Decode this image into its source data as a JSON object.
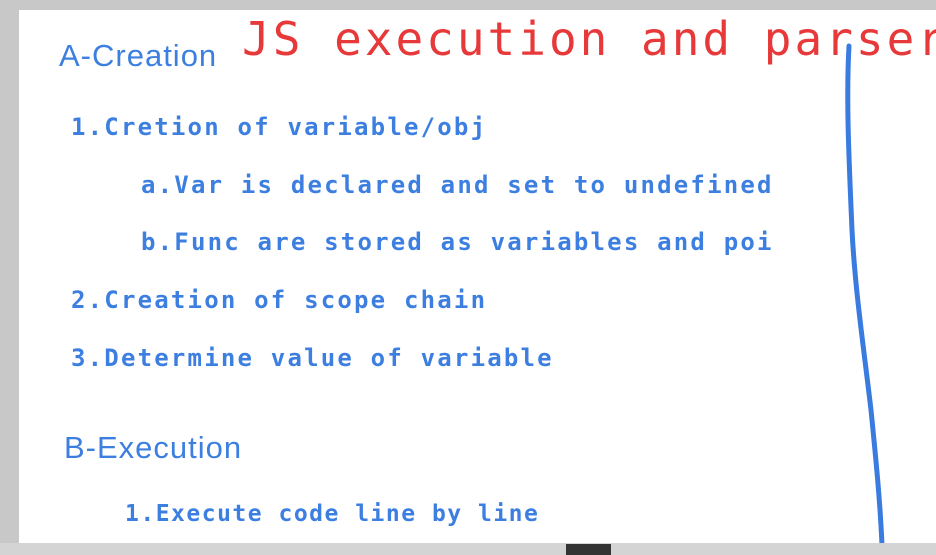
{
  "colors": {
    "title": "#e8393a",
    "text": "#3d7fe0",
    "stroke": "#3a7be0",
    "background": "#ffffff",
    "frame": "#c8c8c8",
    "scroll_thumb": "#333333"
  },
  "slide": {
    "title": "JS execution and parser",
    "section_a": {
      "heading": "A-Creation",
      "items": [
        "1.Cretion of variable/obj",
        "a.Var is declared and set to undefined",
        "b.Func are stored as variables and poi",
        "2.Creation of scope chain",
        "3.Determine value of variable"
      ]
    },
    "section_b": {
      "heading": "B-Execution",
      "items": [
        "1.Execute code line by line"
      ]
    }
  }
}
